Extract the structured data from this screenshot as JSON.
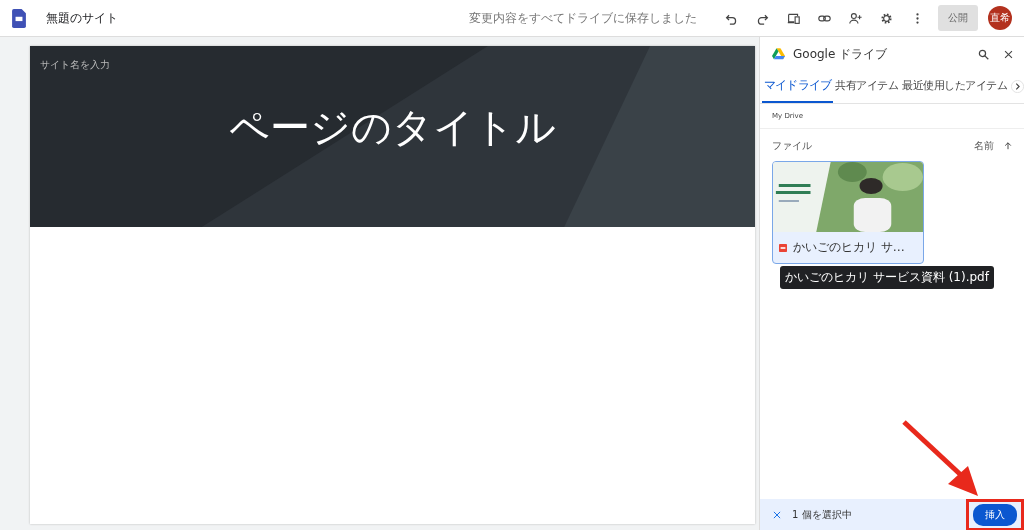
{
  "app": {
    "title": "無題のサイト",
    "save_status": "変更内容をすべてドライブに保存しました",
    "publish_button": "公開",
    "publish_disabled": true,
    "avatar": "直希"
  },
  "banner": {
    "site_name_placeholder": "サイト名を入力",
    "page_title": "ページのタイトル"
  },
  "drive_panel": {
    "title": "Google ドライブ",
    "tabs": [
      {
        "label": "マイドライブ",
        "selected": true
      },
      {
        "label": "共有アイテム",
        "selected": false
      },
      {
        "label": "最近使用したアイテム",
        "selected": false
      }
    ],
    "breadcrumb": "My Drive",
    "section": "ファイル",
    "sort_label": "名前",
    "files": [
      {
        "kind": "picture",
        "name": "かいごのヒカリ サ…",
        "tooltip": "かいごのヒカリ サービス資料 (1).pdf",
        "selected": true
      }
    ],
    "selection_text": "1 個を選択中",
    "insert_button": "挿入"
  }
}
